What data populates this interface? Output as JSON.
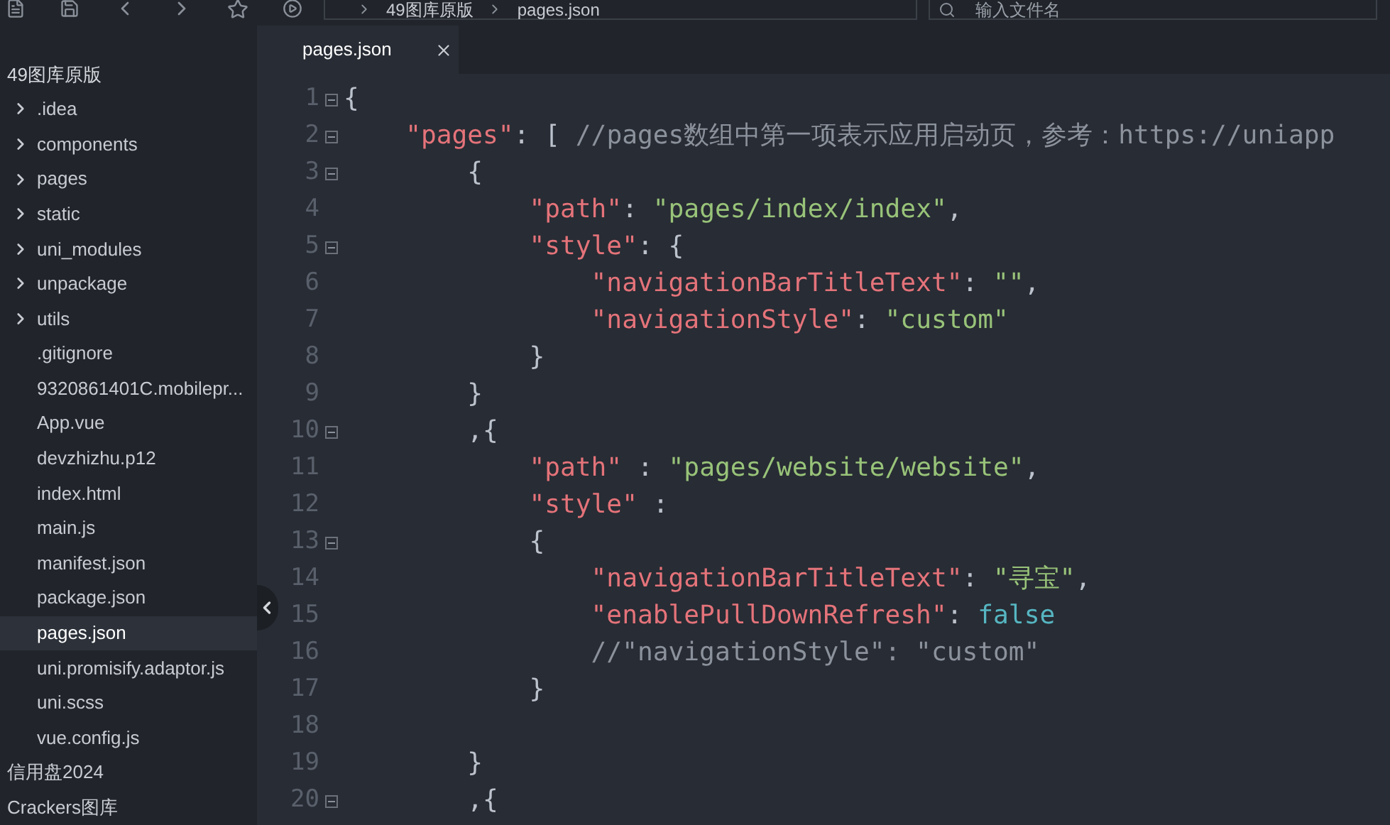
{
  "toolbar": {
    "breadcrumb": [
      "49图库原版",
      "pages.json"
    ],
    "search": {
      "placeholder": "输入文件名"
    }
  },
  "sidebar": {
    "projects": [
      {
        "label": "49图库原版",
        "expanded": true,
        "children": [
          {
            "label": ".idea",
            "kind": "folder",
            "expanded": false,
            "selected": false
          },
          {
            "label": "components",
            "kind": "folder",
            "expanded": false,
            "selected": false
          },
          {
            "label": "pages",
            "kind": "folder",
            "expanded": false,
            "selected": false
          },
          {
            "label": "static",
            "kind": "folder",
            "expanded": false,
            "selected": false
          },
          {
            "label": "uni_modules",
            "kind": "folder",
            "expanded": false,
            "selected": false
          },
          {
            "label": "unpackage",
            "kind": "folder",
            "expanded": false,
            "selected": false
          },
          {
            "label": "utils",
            "kind": "folder",
            "expanded": false,
            "selected": false
          },
          {
            "label": ".gitignore",
            "kind": "file",
            "selected": false
          },
          {
            "label": "9320861401C.mobilepr...",
            "kind": "file",
            "selected": false
          },
          {
            "label": "App.vue",
            "kind": "file",
            "selected": false
          },
          {
            "label": "devzhizhu.p12",
            "kind": "file",
            "selected": false
          },
          {
            "label": "index.html",
            "kind": "file",
            "selected": false
          },
          {
            "label": "main.js",
            "kind": "file",
            "selected": false
          },
          {
            "label": "manifest.json",
            "kind": "file",
            "selected": false
          },
          {
            "label": "package.json",
            "kind": "file",
            "selected": false
          },
          {
            "label": "pages.json",
            "kind": "file",
            "selected": true
          },
          {
            "label": "uni.promisify.adaptor.js",
            "kind": "file",
            "selected": false
          },
          {
            "label": "uni.scss",
            "kind": "file",
            "selected": false
          },
          {
            "label": "vue.config.js",
            "kind": "file",
            "selected": false
          }
        ]
      },
      {
        "label": "信用盘2024",
        "expanded": false
      },
      {
        "label": "Crackers图库",
        "expanded": false
      }
    ]
  },
  "tabs": [
    {
      "label": "pages.json",
      "selected": true
    }
  ],
  "editor": {
    "lines": [
      {
        "number": "1",
        "fold": true,
        "tokens": [
          {
            "kind": "punct",
            "text": "{"
          }
        ]
      },
      {
        "number": "2",
        "fold": true,
        "tokens": [
          {
            "kind": "key",
            "text": "    \"pages\""
          },
          {
            "kind": "punct",
            "text": ": [ "
          },
          {
            "kind": "comment",
            "text": "//pages数组中第一项表示应用启动页，参考：https://uniapp"
          }
        ]
      },
      {
        "number": "3",
        "fold": true,
        "tokens": [
          {
            "kind": "punct",
            "text": "        {"
          }
        ]
      },
      {
        "number": "4",
        "fold": false,
        "tokens": [
          {
            "kind": "key",
            "text": "            \"path\""
          },
          {
            "kind": "punct",
            "text": ": "
          },
          {
            "kind": "string",
            "text": "\"pages/index/index\""
          },
          {
            "kind": "punct",
            "text": ","
          }
        ]
      },
      {
        "number": "5",
        "fold": true,
        "tokens": [
          {
            "kind": "key",
            "text": "            \"style\""
          },
          {
            "kind": "punct",
            "text": ": {"
          }
        ]
      },
      {
        "number": "6",
        "fold": false,
        "tokens": [
          {
            "kind": "key",
            "text": "                \"navigationBarTitleText\""
          },
          {
            "kind": "punct",
            "text": ": "
          },
          {
            "kind": "string",
            "text": "\"\""
          },
          {
            "kind": "punct",
            "text": ","
          }
        ]
      },
      {
        "number": "7",
        "fold": false,
        "tokens": [
          {
            "kind": "key",
            "text": "                \"navigationStyle\""
          },
          {
            "kind": "punct",
            "text": ": "
          },
          {
            "kind": "string",
            "text": "\"custom\""
          }
        ]
      },
      {
        "number": "8",
        "fold": false,
        "tokens": [
          {
            "kind": "punct",
            "text": "            }"
          }
        ]
      },
      {
        "number": "9",
        "fold": false,
        "tokens": [
          {
            "kind": "punct",
            "text": "        }"
          }
        ]
      },
      {
        "number": "10",
        "fold": true,
        "tokens": [
          {
            "kind": "punct",
            "text": "        ,{"
          }
        ]
      },
      {
        "number": "11",
        "fold": false,
        "tokens": [
          {
            "kind": "key",
            "text": "            \"path\""
          },
          {
            "kind": "punct",
            "text": " : "
          },
          {
            "kind": "string",
            "text": "\"pages/website/website\""
          },
          {
            "kind": "punct",
            "text": ","
          }
        ]
      },
      {
        "number": "12",
        "fold": false,
        "tokens": [
          {
            "kind": "key",
            "text": "            \"style\""
          },
          {
            "kind": "punct",
            "text": " :"
          }
        ]
      },
      {
        "number": "13",
        "fold": true,
        "tokens": [
          {
            "kind": "punct",
            "text": "            {"
          }
        ]
      },
      {
        "number": "14",
        "fold": false,
        "tokens": [
          {
            "kind": "key",
            "text": "                \"navigationBarTitleText\""
          },
          {
            "kind": "punct",
            "text": ": "
          },
          {
            "kind": "string",
            "text": "\"寻宝\""
          },
          {
            "kind": "punct",
            "text": ","
          }
        ]
      },
      {
        "number": "15",
        "fold": false,
        "tokens": [
          {
            "kind": "key",
            "text": "                \"enablePullDownRefresh\""
          },
          {
            "kind": "punct",
            "text": ": "
          },
          {
            "kind": "bool",
            "text": "false"
          }
        ]
      },
      {
        "number": "16",
        "fold": false,
        "tokens": [
          {
            "kind": "comment",
            "text": "                //\"navigationStyle\": \"custom\""
          }
        ]
      },
      {
        "number": "17",
        "fold": false,
        "tokens": [
          {
            "kind": "punct",
            "text": "            }"
          }
        ]
      },
      {
        "number": "18",
        "fold": false
      },
      {
        "number": "19",
        "fold": false,
        "tokens": [
          {
            "kind": "punct",
            "text": "        }"
          }
        ]
      },
      {
        "number": "20",
        "fold": true,
        "tokens": [
          {
            "kind": "punct",
            "text": "        ,{"
          }
        ]
      }
    ]
  }
}
